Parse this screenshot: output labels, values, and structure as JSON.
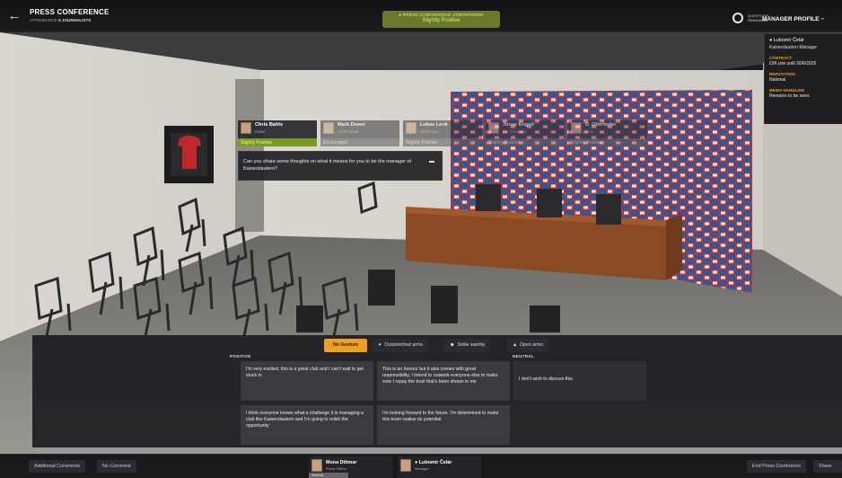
{
  "header": {
    "title": "PRESS CONFERENCE",
    "attendance_label": "ATTENDANCE",
    "attendance_value": "5 JOURNALISTS",
    "atmosphere_label": "PRESS CONFERENCE ATMOSPHERE",
    "atmosphere_value": "Slightly Positive",
    "questions_label": "QUESTIONS REMAINING",
    "profile_title": "MANAGER PROFILE"
  },
  "profile": {
    "name": "Lubomír Čelár",
    "role": "Kaiserslautern Manager",
    "contract_label": "CONTRACT",
    "contract_value": "£9K p/w until 30/6/2025",
    "reputation_label": "REPUTATION",
    "reputation_value": "National",
    "media_label": "MEDIA HANDLING",
    "media_value": "Remains to be seen"
  },
  "journalists": [
    {
      "name": "Chris Bahls",
      "outlet": "Kicker",
      "mood": "Slightly Positive"
    },
    {
      "name": "Mark Dewel",
      "outlet": "OneFootball",
      "mood": "Encouraged"
    },
    {
      "name": "Lukas Lenk",
      "outlet": "SPOX.com",
      "mood": "Slightly Positive"
    },
    {
      "name": "Jonas Engelt",
      "outlet": "Die Rheinpfalz",
      "mood": "Slightly Positive"
    },
    {
      "name": "D. Oberhofer",
      "outlet": "BILD",
      "mood": "Slightly Positive"
    }
  ],
  "question": "Can you share some thoughts on what it means for you to be the manager of Kaiserslautern?",
  "gestures": [
    "No Gesture",
    "Outstretched arms",
    "Smile warmly",
    "Open arms"
  ],
  "columns": {
    "positive": "POSITIVE",
    "neutral": "NEUTRAL"
  },
  "answers": [
    "I'm very excited, this is a great club and I can't wait to get stuck in",
    "This is an honour but it also comes with great responsibility. I intend to outwork everyone else to make sure I repay the trust that's been shown in me",
    "I don't wish to discuss this",
    "I think everyone knows what a challenge it is managing a club like Kaiserslautern and I'm going to relish the opportunity",
    "I'm looking forward to the future. I'm determined to make this team realise its potential"
  ],
  "bottom": {
    "additional_comments": "Additional Comments",
    "no_comment": "No Comment",
    "press_officer_name": "Mona Dittmar",
    "press_officer_role": "Press Officer",
    "press_officer_mood": "Neutral",
    "manager_name": "Lubomír Čelár",
    "manager_role": "Manager",
    "end_conference": "End Press Conference",
    "share": "Share"
  },
  "colors": {
    "accent": "#f0a020",
    "positive": "#7a9a22"
  }
}
